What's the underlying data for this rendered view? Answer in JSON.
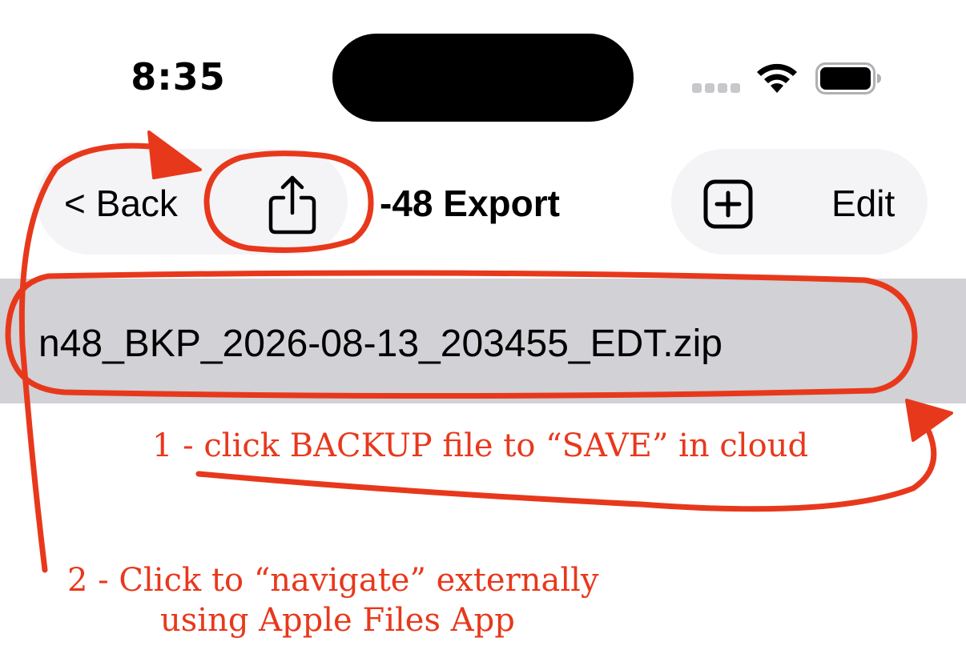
{
  "status_bar": {
    "time": "8:35",
    "icons": [
      "cellular-signal-icon",
      "wifi-icon",
      "battery-icon"
    ]
  },
  "nav": {
    "back_label": "< Back",
    "share_icon": "share-icon",
    "title": "-48 Export",
    "add_icon": "plus-square-icon",
    "edit_label": "Edit",
    "pill_background": "#f4f4f6"
  },
  "file_list": {
    "items": [
      {
        "name": "n48_BKP_2026-08-13_203455_EDT.zip",
        "selected": true
      }
    ],
    "selected_background": "#d1d1d6"
  },
  "annotations": {
    "color": "#e8381c",
    "note_1": "1 - click BACKUP file to “SAVE” in cloud",
    "note_2_line_1": "2 - Click to “navigate” externally",
    "note_2_line_2": "using Apple Files App"
  }
}
